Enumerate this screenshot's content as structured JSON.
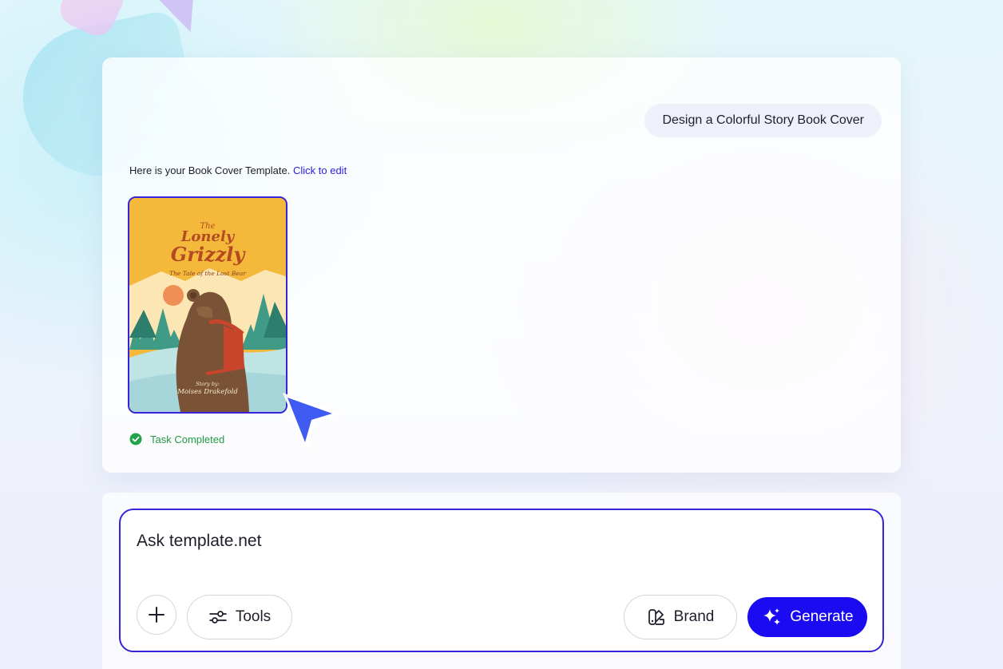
{
  "conversation": {
    "user_prompt": "Design a Colorful Story Book Cover",
    "reply_text": "Here is your Book Cover Template.",
    "reply_link": "Click to edit",
    "status_text": "Task Completed"
  },
  "book_cover": {
    "title_small": "The",
    "title_line1": "Lonely",
    "title_line2": "Grizzly",
    "subtitle": "The Tale of the Lost Bear",
    "byline": "Story by:",
    "author": "Moises Drakefold"
  },
  "composer": {
    "placeholder": "Ask template.net",
    "tools_label": "Tools",
    "brand_label": "Brand",
    "generate_label": "Generate"
  },
  "icons": {
    "add": "plus-icon",
    "tools": "sliders-icon",
    "brand": "palette-icon",
    "generate": "sparkle-icon",
    "status": "check-circle-icon",
    "pointer": "cursor-arrow-icon"
  },
  "colors": {
    "accent": "#1a0bf0",
    "border_accent": "#3524d9",
    "link": "#2a1de0",
    "success": "#1f9a44"
  }
}
